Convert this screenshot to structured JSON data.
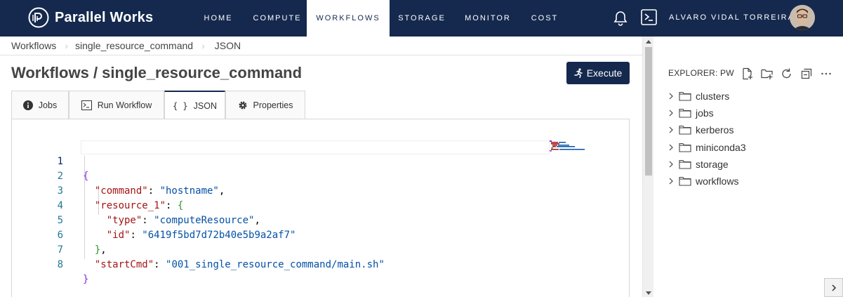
{
  "brand": {
    "name": "Parallel Works"
  },
  "nav": {
    "items": [
      {
        "label": "HOME"
      },
      {
        "label": "COMPUTE"
      },
      {
        "label": "WORKFLOWS"
      },
      {
        "label": "STORAGE"
      },
      {
        "label": "MONITOR"
      },
      {
        "label": "COST"
      }
    ],
    "active": "WORKFLOWS",
    "user_name": "ALVARO VIDAL TORREIRA"
  },
  "breadcrumb": [
    {
      "label": "Workflows"
    },
    {
      "label": "single_resource_command"
    },
    {
      "label": "JSON"
    }
  ],
  "page": {
    "title": "Workflows / single_resource_command",
    "execute_label": "Execute"
  },
  "tabs": [
    {
      "label": "Jobs",
      "icon": "info-icon"
    },
    {
      "label": "Run Workflow",
      "icon": "terminal-icon"
    },
    {
      "label": "JSON",
      "icon": "braces-icon"
    },
    {
      "label": "Properties",
      "icon": "gear-icon"
    }
  ],
  "active_tab": "JSON",
  "editor": {
    "line_numbers": [
      "1",
      "2",
      "3",
      "4",
      "5",
      "6",
      "7",
      "8"
    ],
    "lines": [
      {
        "key": "",
        "value": ""
      },
      {
        "key": "\"command\"",
        "value": "\"hostname\""
      },
      {
        "key": "\"resource_1\"",
        "value": ""
      },
      {
        "key": "\"type\"",
        "value": "\"computeResource\""
      },
      {
        "key": "\"id\"",
        "value": "\"6419f5bd7d72b40e5b9a2af7\""
      },
      {
        "key": "",
        "value": ""
      },
      {
        "key": "\"startCmd\"",
        "value": "\"001_single_resource_command/main.sh\""
      },
      {
        "key": "",
        "value": ""
      }
    ]
  },
  "explorer": {
    "title": "EXPLORER: PW",
    "items": [
      {
        "label": "clusters"
      },
      {
        "label": "jobs"
      },
      {
        "label": "kerberos"
      },
      {
        "label": "miniconda3"
      },
      {
        "label": "storage"
      },
      {
        "label": "workflows"
      }
    ]
  },
  "colors": {
    "navbar": "#15294e",
    "json_key": "#a31515",
    "json_string": "#0451a5",
    "line_number": "#237893"
  }
}
